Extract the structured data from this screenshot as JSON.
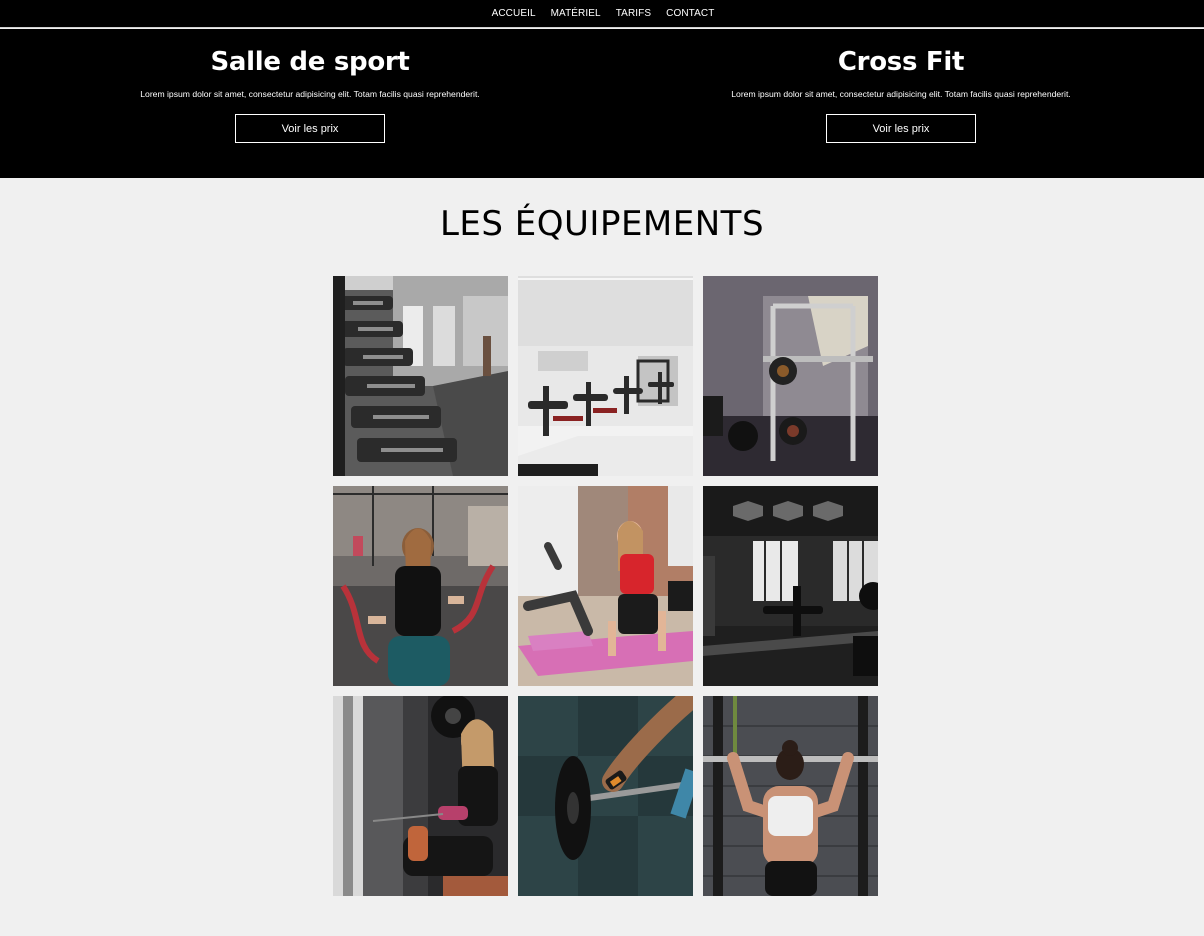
{
  "nav": {
    "items": [
      {
        "label": "ACCUEIL"
      },
      {
        "label": "MATÉRIEL"
      },
      {
        "label": "TARIFS"
      },
      {
        "label": "CONTACT"
      }
    ]
  },
  "hero": {
    "blocks": [
      {
        "title": "Salle de sport",
        "text": "Lorem ipsum dolor sit amet, consectetur adipisicing elit. Totam facilis quasi reprehenderit.",
        "button_label": "Voir les prix"
      },
      {
        "title": "Cross Fit",
        "text": "Lorem ipsum dolor sit amet, consectetur adipisicing elit. Totam facilis quasi reprehenderit.",
        "button_label": "Voir les prix"
      }
    ]
  },
  "equipment": {
    "title": "LES ÉQUIPEMENTS",
    "photos": [
      {
        "subject": "dumbbell-rack-photo"
      },
      {
        "subject": "bright-gym-bikes-photo"
      },
      {
        "subject": "squat-rack-photo"
      },
      {
        "subject": "battle-ropes-photo"
      },
      {
        "subject": "yoga-mat-workout-photo"
      },
      {
        "subject": "dark-gym-machines-photo"
      },
      {
        "subject": "cable-machine-woman-photo"
      },
      {
        "subject": "barbell-lift-photo"
      },
      {
        "subject": "pull-up-woman-photo"
      }
    ]
  },
  "colors": {
    "nav_bg": "#000000",
    "hero_bg": "#000000",
    "page_bg": "#f0f0f0",
    "text_light": "#ffffff",
    "text_dark": "#000000"
  }
}
